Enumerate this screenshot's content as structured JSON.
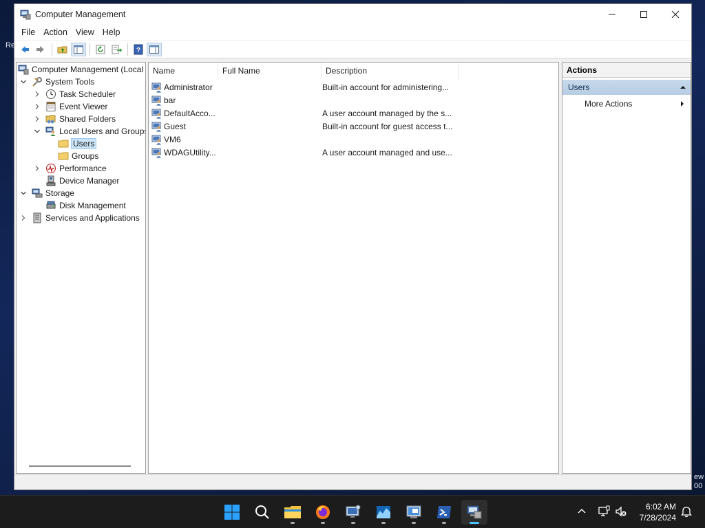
{
  "desktop": {
    "frag_left": "Re",
    "frag_right_1": "ew",
    "frag_right_2": "00"
  },
  "window": {
    "title": "Computer Management",
    "controls": {
      "minimize": "minimize",
      "maximize": "maximize",
      "close": "close"
    }
  },
  "menu": {
    "file": "File",
    "action": "Action",
    "view": "View",
    "help": "Help"
  },
  "toolbar": {
    "buttons": [
      "back-icon",
      "forward-icon",
      "up-folder-icon",
      "show-hide-tree-icon",
      "refresh-icon",
      "export-list-icon",
      "help-icon",
      "show-action-pane-icon"
    ]
  },
  "tree": {
    "root": "Computer Management (Local",
    "system_tools": "System Tools",
    "task_scheduler": "Task Scheduler",
    "event_viewer": "Event Viewer",
    "shared_folders": "Shared Folders",
    "local_users_groups": "Local Users and Groups",
    "users": "Users",
    "groups": "Groups",
    "performance": "Performance",
    "device_manager": "Device Manager",
    "storage": "Storage",
    "disk_management": "Disk Management",
    "services_apps": "Services and Applications"
  },
  "list": {
    "columns": {
      "name": "Name",
      "full_name": "Full Name",
      "description": "Description"
    },
    "rows": [
      {
        "name": "Administrator",
        "full_name": "",
        "description": "Built-in account for administering..."
      },
      {
        "name": "bar",
        "full_name": "",
        "description": ""
      },
      {
        "name": "DefaultAcco...",
        "full_name": "",
        "description": "A user account managed by the s..."
      },
      {
        "name": "Guest",
        "full_name": "",
        "description": "Built-in account for guest access t..."
      },
      {
        "name": "VM6",
        "full_name": "",
        "description": ""
      },
      {
        "name": "WDAGUtility...",
        "full_name": "",
        "description": "A user account managed and use..."
      }
    ]
  },
  "actions": {
    "title": "Actions",
    "section": "Users",
    "more_actions": "More Actions"
  },
  "taskbar": {
    "apps": [
      "windows-start-icon",
      "search-icon",
      "file-explorer-icon",
      "firefox-icon",
      "remote-desktop-icon",
      "performance-monitor-icon",
      "server-manager-icon",
      "powershell-icon",
      "computer-management-icon"
    ],
    "clock_time": "6:02 AM",
    "clock_date": "7/28/2024"
  },
  "colors": {
    "selection": "#cce4f7",
    "actions_header": "#b7cde3",
    "taskbar": "#1c1c1c",
    "accent": "#4cc2ff"
  }
}
